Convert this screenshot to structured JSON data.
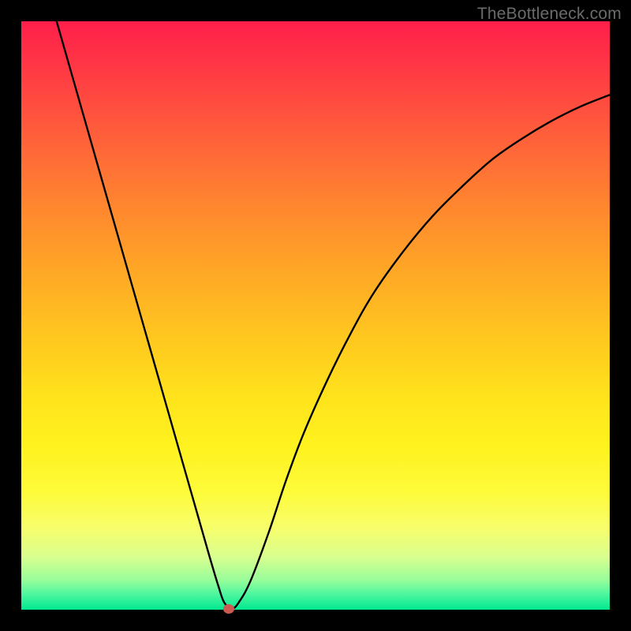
{
  "watermark": "TheBottleneck.com",
  "colors": {
    "frame": "#000000",
    "curve": "#000000",
    "marker": "#cc5a53"
  },
  "chart_data": {
    "type": "line",
    "title": "",
    "xlabel": "",
    "ylabel": "",
    "xlim": [
      0,
      100
    ],
    "ylim": [
      0,
      100
    ],
    "grid": false,
    "legend": false,
    "series": [
      {
        "name": "curve",
        "x": [
          6,
          8,
          10,
          12,
          14,
          16,
          18,
          20,
          22,
          24,
          26,
          28,
          30,
          32,
          33.5,
          34.5,
          35.8,
          37,
          39,
          42,
          45,
          48,
          52,
          56,
          60,
          65,
          70,
          75,
          80,
          85,
          90,
          95,
          100
        ],
        "y": [
          100,
          93,
          86,
          79,
          72,
          65,
          58,
          51,
          44,
          37,
          30,
          23,
          16,
          9,
          4,
          1.2,
          0.2,
          1.3,
          5,
          13,
          22,
          30,
          39,
          47,
          54,
          61,
          67,
          72,
          76.5,
          80,
          83,
          85.5,
          87.5
        ]
      }
    ],
    "marker": {
      "x": 35.2,
      "y": 0.2
    },
    "note": "Values are estimated from pixel positions; the chart has no visible axes, ticks, or labels."
  }
}
